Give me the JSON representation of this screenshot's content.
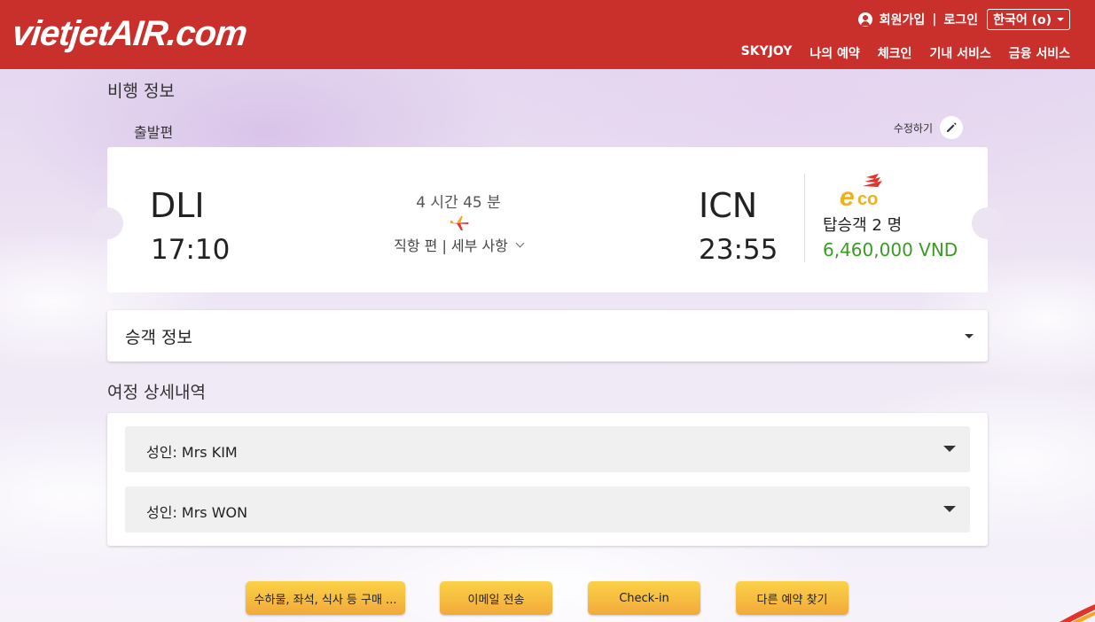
{
  "header": {
    "logo": "vietjetAIR.com",
    "signup": "회원가입",
    "separator": "|",
    "login": "로그인",
    "language": "한국어 (o)",
    "nav": [
      "SKYJOY",
      "나의 예약",
      "체크인",
      "기내 서비스",
      "금융 서비스"
    ]
  },
  "flight_info": {
    "title": "비행 정보",
    "subtitle": "출발편",
    "edit_label": "수정하기",
    "origin": {
      "code": "DLI",
      "time": "17:10"
    },
    "destination": {
      "code": "ICN",
      "time": "23:55"
    },
    "duration": "4 시간 45 분",
    "direct_details": "직항 편 | 세부 사항",
    "fare_class": "eco",
    "passengers": "탑승객 2 명",
    "price": "6,460,000 VND",
    "price_color": "#3a9d23"
  },
  "passenger_info": {
    "title": "승객 정보"
  },
  "itinerary": {
    "title": "여정 상세내역",
    "rows": [
      {
        "label": "성인: Mrs KIM"
      },
      {
        "label": "성인: Mrs WON"
      }
    ]
  },
  "actions": [
    {
      "label": "수하물, 좌석, 식사 등 구매 ..."
    },
    {
      "label": "이메일 전송"
    },
    {
      "label": "Check-in"
    },
    {
      "label": "다른 예약 찾기"
    }
  ],
  "colors": {
    "brand_red": "#c9302c",
    "button_yellow": "#fbd246"
  }
}
